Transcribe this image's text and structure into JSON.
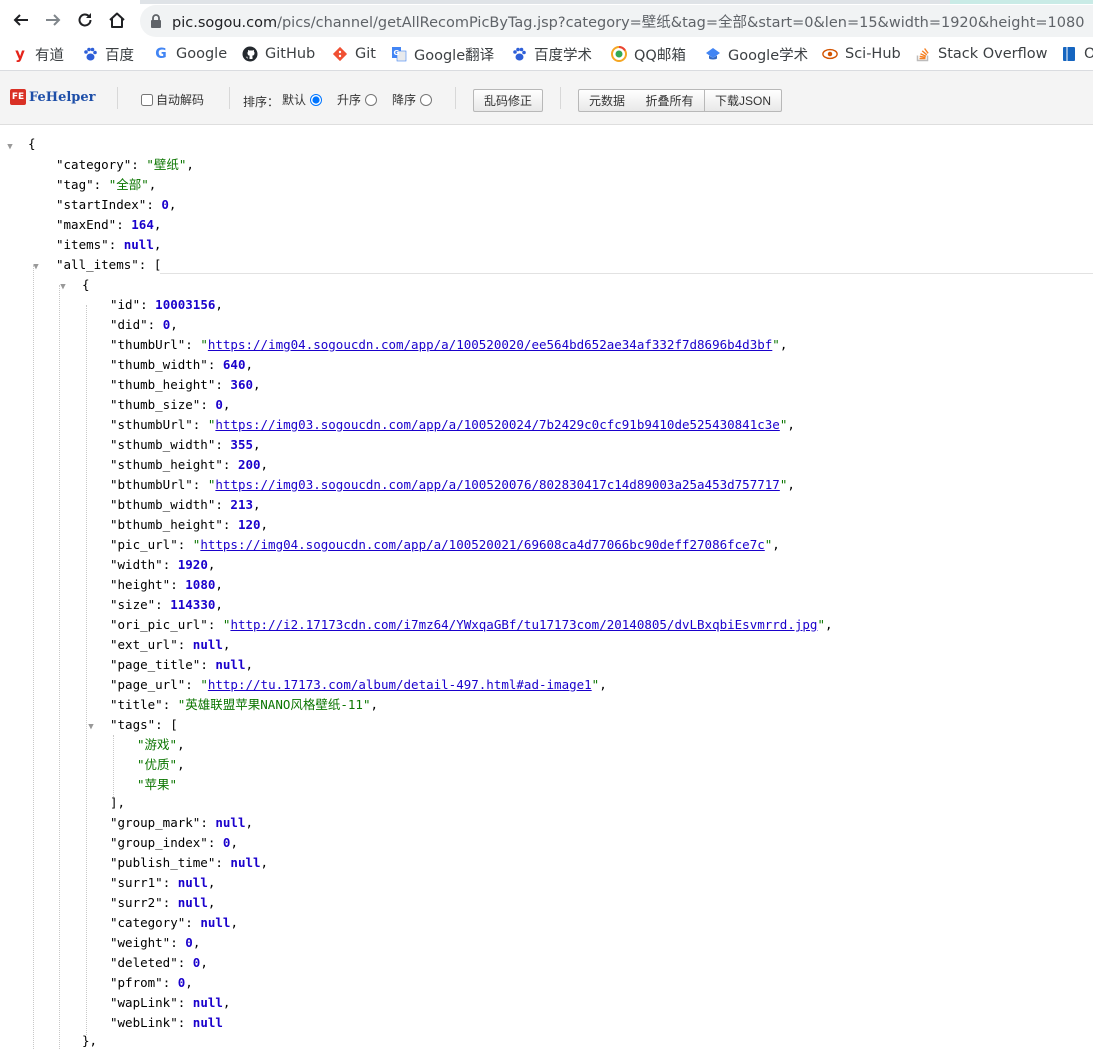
{
  "browser": {
    "url_host": "pic.sogou.com",
    "url_rest": "/pics/channel/getAllRecomPicByTag.jsp?category=壁纸&tag=全部&start=0&len=15&width=1920&height=1080"
  },
  "bookmarks": [
    {
      "label": "有道",
      "icon": "youdao-icon",
      "color": "#e5231a"
    },
    {
      "label": "百度",
      "icon": "baidu-paw-icon",
      "color": "#2e5fd8"
    },
    {
      "label": "Google",
      "icon": "google-g-icon",
      "color": "#4285f4"
    },
    {
      "label": "GitHub",
      "icon": "github-icon",
      "color": "#24292e"
    },
    {
      "label": "Git",
      "icon": "git-icon",
      "color": "#f05033"
    },
    {
      "label": "Google翻译",
      "icon": "google-translate-icon",
      "color": "#4285f4"
    },
    {
      "label": "百度学术",
      "icon": "baidu-paw-icon",
      "color": "#2e5fd8"
    },
    {
      "label": "QQ邮箱",
      "icon": "qqmail-icon",
      "color": "#f5a623"
    },
    {
      "label": "Google学术",
      "icon": "scholar-cap-icon",
      "color": "#4285f4"
    },
    {
      "label": "Sci-Hub",
      "icon": "scihub-icon",
      "color": "#d35400"
    },
    {
      "label": "Stack Overflow",
      "icon": "stackoverflow-icon",
      "color": "#f48024"
    },
    {
      "label": "O",
      "icon": "bookmark-icon",
      "color": "#1565c0"
    }
  ],
  "fehelper": {
    "logo_mark": "FE",
    "logo_text": "FeHelper",
    "auto_decode_label": "自动解码",
    "sort_label": "排序：",
    "sort_options": [
      "默认",
      "升序",
      "降序"
    ],
    "sort_selected": "默认",
    "fix_button": "乱码修正",
    "meta_button": "元数据",
    "fold_button": "折叠所有",
    "download_button": "下载JSON"
  },
  "json": {
    "root_open": "{",
    "category": "壁纸",
    "tag": "全部",
    "startIndex": "0",
    "maxEnd": "164",
    "items": "null",
    "item0": {
      "id": "10003156",
      "did": "0",
      "thumbUrl": "https://img04.sogoucdn.com/app/a/100520020/ee564bd652ae34af332f7d8696b4d3bf",
      "thumb_width": "640",
      "thumb_height": "360",
      "thumb_size": "0",
      "sthumbUrl": "https://img03.sogoucdn.com/app/a/100520024/7b2429c0cfc91b9410de525430841c3e",
      "sthumb_width": "355",
      "sthumb_height": "200",
      "bthumbUrl": "https://img03.sogoucdn.com/app/a/100520076/802830417c14d89003a25a453d757717",
      "bthumb_width": "213",
      "bthumb_height": "120",
      "pic_url": "https://img04.sogoucdn.com/app/a/100520021/69608ca4d77066bc90deff27086fce7c",
      "width": "1920",
      "height": "1080",
      "size": "114330",
      "ori_pic_url": "http://i2.17173cdn.com/i7mz64/YWxqaGBf/tu17173com/20140805/dvLBxqbiEsvmrrd.jpg",
      "ext_url": "null",
      "page_title": "null",
      "page_url": "http://tu.17173.com/album/detail-497.html#ad-image1",
      "title": "英雄联盟苹果NANO风格壁纸-11",
      "tags": [
        "游戏",
        "优质",
        "苹果"
      ],
      "group_mark": "null",
      "group_index": "0",
      "publish_time": "null",
      "surr1": "null",
      "surr2": "null",
      "category": "null",
      "weight": "0",
      "deleted": "0",
      "pfrom": "0",
      "wapLink": "null",
      "webLink": "null"
    }
  }
}
